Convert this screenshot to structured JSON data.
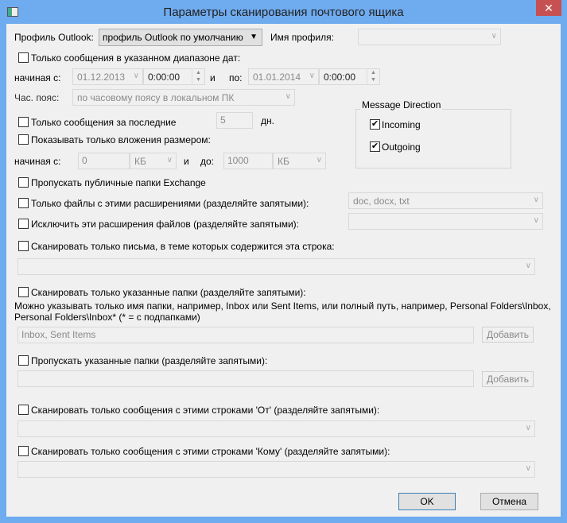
{
  "window": {
    "title": "Параметры сканирования почтового ящика",
    "close": "✕"
  },
  "profile": {
    "label": "Профиль Outlook:",
    "value": "профиль Outlook по умолчанию",
    "name_label": "Имя профиля:",
    "name_value": ""
  },
  "date_range": {
    "label": "Только сообщения в указанном диапазоне дат:",
    "checked": false,
    "from_label": "начиная с:",
    "from_date": "01.12.2013",
    "from_time": "0:00:00",
    "and": "и",
    "to_label": "по:",
    "to_date": "01.01.2014",
    "to_time": "0:00:00"
  },
  "timezone": {
    "label": "Час. пояс:",
    "value": "по часовому поясу в локальном ПК"
  },
  "last_days": {
    "label": "Только сообщения за последние",
    "value": "5",
    "unit": "дн."
  },
  "attachments": {
    "label": "Показывать только вложения размером:",
    "from_label": "начиная с:",
    "from_value": "0",
    "from_unit": "КБ",
    "and": "и",
    "to_label": "до:",
    "to_value": "1000",
    "to_unit": "КБ"
  },
  "direction": {
    "title": "Message Direction",
    "incoming": "Incoming",
    "outgoing": "Outgoing"
  },
  "skip_public": "Пропускать публичные папки Exchange",
  "only_ext": {
    "label": "Только файлы с этими расширениями (разделяйте запятыми):",
    "value": "doc, docx, txt"
  },
  "exclude_ext": {
    "label": "Исключить эти расширения файлов (разделяйте запятыми):",
    "value": ""
  },
  "subject": {
    "label": "Сканировать только письма, в теме которых содержится эта строка:",
    "value": ""
  },
  "folders": {
    "label": "Сканировать только указанные папки (разделяйте запятыми):",
    "help1": "Можно указывать только имя папки, например, Inbox или Sent Items, или полный путь, например, Personal Folders\\Inbox,",
    "help2": "Personal Folders\\Inbox*  (* = с подпапками)",
    "value": "Inbox, Sent Items",
    "add": "Добавить"
  },
  "skip_folders": {
    "label": "Пропускать указанные папки (разделяйте запятыми):",
    "value": "",
    "add": "Добавить"
  },
  "from": {
    "label": "Сканировать только сообщения с этими строками 'От' (разделяйте запятыми):"
  },
  "to": {
    "label": "Сканировать только сообщения с этими строками 'Кому' (разделяйте запятыми):"
  },
  "buttons": {
    "ok": "OK",
    "cancel": "Отмена"
  },
  "check_mark": "✔"
}
